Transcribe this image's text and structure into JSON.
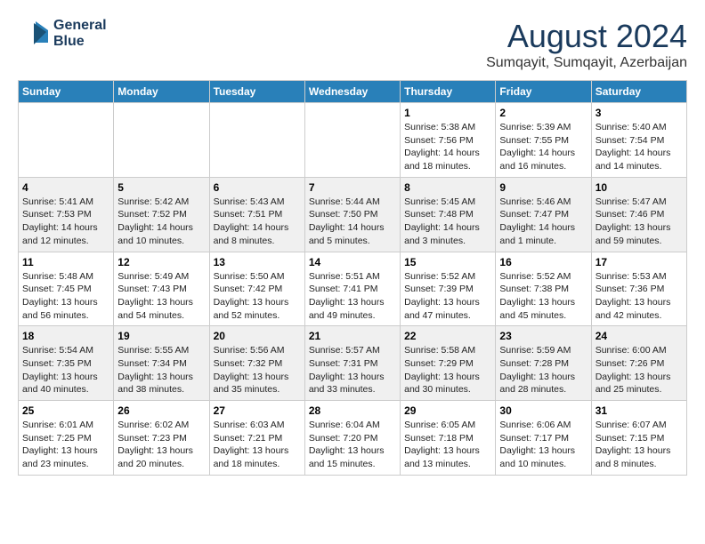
{
  "logo": {
    "line1": "General",
    "line2": "Blue"
  },
  "title": "August 2024",
  "subtitle": "Sumqayit, Sumqayit, Azerbaijan",
  "days_of_week": [
    "Sunday",
    "Monday",
    "Tuesday",
    "Wednesday",
    "Thursday",
    "Friday",
    "Saturday"
  ],
  "weeks": [
    [
      {
        "day": "",
        "info": ""
      },
      {
        "day": "",
        "info": ""
      },
      {
        "day": "",
        "info": ""
      },
      {
        "day": "",
        "info": ""
      },
      {
        "day": "1",
        "info": "Sunrise: 5:38 AM\nSunset: 7:56 PM\nDaylight: 14 hours\nand 18 minutes."
      },
      {
        "day": "2",
        "info": "Sunrise: 5:39 AM\nSunset: 7:55 PM\nDaylight: 14 hours\nand 16 minutes."
      },
      {
        "day": "3",
        "info": "Sunrise: 5:40 AM\nSunset: 7:54 PM\nDaylight: 14 hours\nand 14 minutes."
      }
    ],
    [
      {
        "day": "4",
        "info": "Sunrise: 5:41 AM\nSunset: 7:53 PM\nDaylight: 14 hours\nand 12 minutes."
      },
      {
        "day": "5",
        "info": "Sunrise: 5:42 AM\nSunset: 7:52 PM\nDaylight: 14 hours\nand 10 minutes."
      },
      {
        "day": "6",
        "info": "Sunrise: 5:43 AM\nSunset: 7:51 PM\nDaylight: 14 hours\nand 8 minutes."
      },
      {
        "day": "7",
        "info": "Sunrise: 5:44 AM\nSunset: 7:50 PM\nDaylight: 14 hours\nand 5 minutes."
      },
      {
        "day": "8",
        "info": "Sunrise: 5:45 AM\nSunset: 7:48 PM\nDaylight: 14 hours\nand 3 minutes."
      },
      {
        "day": "9",
        "info": "Sunrise: 5:46 AM\nSunset: 7:47 PM\nDaylight: 14 hours\nand 1 minute."
      },
      {
        "day": "10",
        "info": "Sunrise: 5:47 AM\nSunset: 7:46 PM\nDaylight: 13 hours\nand 59 minutes."
      }
    ],
    [
      {
        "day": "11",
        "info": "Sunrise: 5:48 AM\nSunset: 7:45 PM\nDaylight: 13 hours\nand 56 minutes."
      },
      {
        "day": "12",
        "info": "Sunrise: 5:49 AM\nSunset: 7:43 PM\nDaylight: 13 hours\nand 54 minutes."
      },
      {
        "day": "13",
        "info": "Sunrise: 5:50 AM\nSunset: 7:42 PM\nDaylight: 13 hours\nand 52 minutes."
      },
      {
        "day": "14",
        "info": "Sunrise: 5:51 AM\nSunset: 7:41 PM\nDaylight: 13 hours\nand 49 minutes."
      },
      {
        "day": "15",
        "info": "Sunrise: 5:52 AM\nSunset: 7:39 PM\nDaylight: 13 hours\nand 47 minutes."
      },
      {
        "day": "16",
        "info": "Sunrise: 5:52 AM\nSunset: 7:38 PM\nDaylight: 13 hours\nand 45 minutes."
      },
      {
        "day": "17",
        "info": "Sunrise: 5:53 AM\nSunset: 7:36 PM\nDaylight: 13 hours\nand 42 minutes."
      }
    ],
    [
      {
        "day": "18",
        "info": "Sunrise: 5:54 AM\nSunset: 7:35 PM\nDaylight: 13 hours\nand 40 minutes."
      },
      {
        "day": "19",
        "info": "Sunrise: 5:55 AM\nSunset: 7:34 PM\nDaylight: 13 hours\nand 38 minutes."
      },
      {
        "day": "20",
        "info": "Sunrise: 5:56 AM\nSunset: 7:32 PM\nDaylight: 13 hours\nand 35 minutes."
      },
      {
        "day": "21",
        "info": "Sunrise: 5:57 AM\nSunset: 7:31 PM\nDaylight: 13 hours\nand 33 minutes."
      },
      {
        "day": "22",
        "info": "Sunrise: 5:58 AM\nSunset: 7:29 PM\nDaylight: 13 hours\nand 30 minutes."
      },
      {
        "day": "23",
        "info": "Sunrise: 5:59 AM\nSunset: 7:28 PM\nDaylight: 13 hours\nand 28 minutes."
      },
      {
        "day": "24",
        "info": "Sunrise: 6:00 AM\nSunset: 7:26 PM\nDaylight: 13 hours\nand 25 minutes."
      }
    ],
    [
      {
        "day": "25",
        "info": "Sunrise: 6:01 AM\nSunset: 7:25 PM\nDaylight: 13 hours\nand 23 minutes."
      },
      {
        "day": "26",
        "info": "Sunrise: 6:02 AM\nSunset: 7:23 PM\nDaylight: 13 hours\nand 20 minutes."
      },
      {
        "day": "27",
        "info": "Sunrise: 6:03 AM\nSunset: 7:21 PM\nDaylight: 13 hours\nand 18 minutes."
      },
      {
        "day": "28",
        "info": "Sunrise: 6:04 AM\nSunset: 7:20 PM\nDaylight: 13 hours\nand 15 minutes."
      },
      {
        "day": "29",
        "info": "Sunrise: 6:05 AM\nSunset: 7:18 PM\nDaylight: 13 hours\nand 13 minutes."
      },
      {
        "day": "30",
        "info": "Sunrise: 6:06 AM\nSunset: 7:17 PM\nDaylight: 13 hours\nand 10 minutes."
      },
      {
        "day": "31",
        "info": "Sunrise: 6:07 AM\nSunset: 7:15 PM\nDaylight: 13 hours\nand 8 minutes."
      }
    ]
  ]
}
